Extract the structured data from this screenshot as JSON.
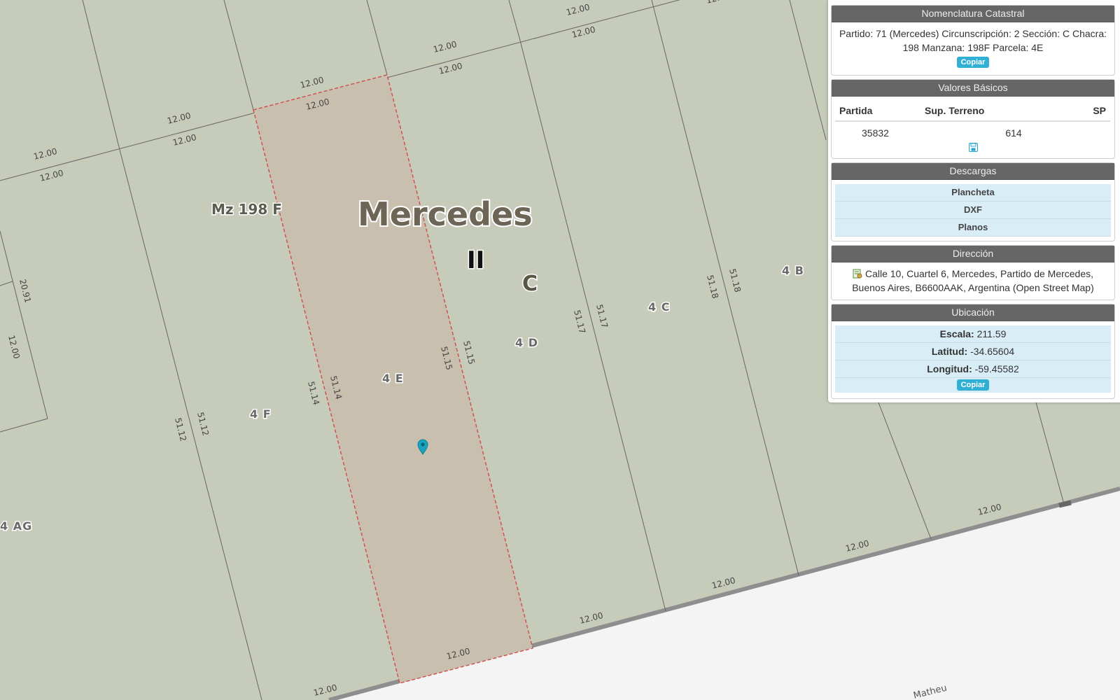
{
  "map": {
    "city_label": "Mercedes",
    "manzana_label": "Mz 198 F",
    "circ_label": "II",
    "section_label": "C",
    "street_label": "Matheu",
    "lots": {
      "4B": "4 B",
      "4C": "4 C",
      "4D": "4 D",
      "4E": "4 E",
      "4F": "4 F",
      "4AG": "4 AG"
    },
    "dims": {
      "front": "12.00",
      "d5112": "51.12",
      "d5114": "51.14",
      "d5115": "51.15",
      "d5117": "51.17",
      "d5118": "51.18",
      "d2091": "20.91"
    },
    "colors": {
      "background": "#c6cbba",
      "parcel_fill": "#c9bfae",
      "parcel_border": "#d24b4b",
      "marker": "#1aa3bf",
      "road": "#f4f4f4"
    }
  },
  "panel": {
    "nomenclatura": {
      "title": "Nomenclatura Catastral",
      "text": "Partido: 71 (Mercedes) Circunscripción: 2 Sección: C Chacra: 198 Manzana: 198F Parcela: 4E",
      "copy_label": "Copiar"
    },
    "valores": {
      "title": "Valores Básicos",
      "headers": [
        "Partida",
        "Sup. Terreno",
        "SP"
      ],
      "row": [
        "35832",
        "614",
        ""
      ],
      "save_icon": "floppy-disk-icon"
    },
    "descargas": {
      "title": "Descargas",
      "items": [
        "Plancheta",
        "DXF",
        "Planos"
      ]
    },
    "direccion": {
      "title": "Dirección",
      "text": "Calle 10, Cuartel 6, Mercedes, Partido de Mercedes, Buenos Aires, B6600AAK, Argentina (Open Street Map)",
      "icon": "map-document-icon"
    },
    "ubicacion": {
      "title": "Ubicación",
      "escala_label": "Escala:",
      "escala_value": "211.59",
      "latitud_label": "Latitud:",
      "latitud_value": "-34.65604",
      "longitud_label": "Longitud:",
      "longitud_value": "-59.45582",
      "copy_label": "Copiar"
    }
  }
}
